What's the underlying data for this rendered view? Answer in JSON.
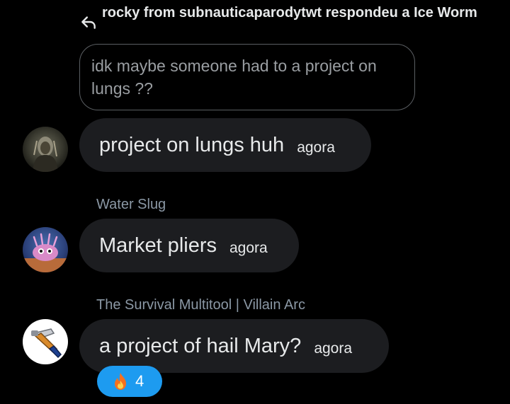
{
  "reply_header": {
    "text": "rocky from subnauticaparodytwt respondeu a Ice Worm",
    "icon": "reply-arrow-icon"
  },
  "quoted_message": {
    "text": "idk maybe someone had to a project on lungs ??"
  },
  "messages": [
    {
      "sender": "",
      "text": "project on lungs huh",
      "time": "agora",
      "avatar": "dark-figure-avatar"
    },
    {
      "sender": "Water Slug",
      "text": "Market pliers",
      "time": "agora",
      "avatar": "water-slug-avatar"
    },
    {
      "sender": "The Survival Multitool | Villain Arc",
      "text": "a project of hail Mary?",
      "time": "agora",
      "avatar": "multitool-avatar",
      "reaction": {
        "emoji": "fire-icon",
        "count": "4",
        "color": "#1d9bf0"
      }
    }
  ],
  "colors": {
    "background": "#000000",
    "bubble": "#1c1d20",
    "quoted_border": "#5b5f63",
    "muted_text": "#8b98a5",
    "accent": "#1d9bf0"
  }
}
